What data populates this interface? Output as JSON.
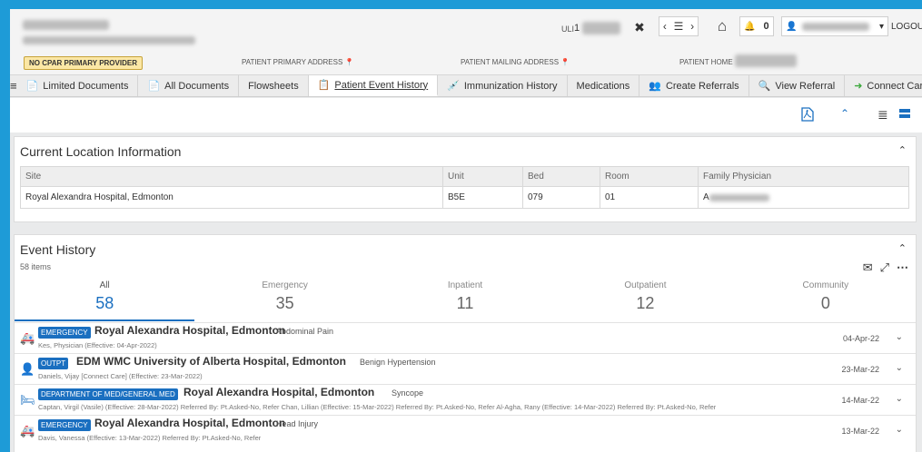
{
  "header": {
    "uli_label": "ULI",
    "uli_value": "1",
    "close_glyph": "✖",
    "nav_prev": "‹",
    "nav_list": "☰",
    "nav_next": "›",
    "home_glyph": "⌂",
    "bell_glyph": "🔔",
    "notification_count": "0",
    "user_glyph": "👤",
    "dropdown_glyph": "▾",
    "logout_label": "LOGOUT",
    "cpar_badge": "NO CPAR PRIMARY PROVIDER",
    "primary_address_label": "PATIENT PRIMARY ADDRESS",
    "mailing_address_label": "PATIENT MAILING ADDRESS",
    "patient_home_label": "PATIENT HOME",
    "pin_glyph": "📍"
  },
  "tabs": [
    {
      "label": "Limited Documents",
      "icon": "📄"
    },
    {
      "label": "All Documents",
      "icon": "📄"
    },
    {
      "label": "Flowsheets",
      "icon": ""
    },
    {
      "label": "Patient Event History",
      "icon": "📋"
    },
    {
      "label": "Immunization History",
      "icon": "💉"
    },
    {
      "label": "Medications",
      "icon": ""
    },
    {
      "label": "Create Referrals",
      "icon": "👥"
    },
    {
      "label": "View Referral",
      "icon": "🔍"
    },
    {
      "label": "Connect Care",
      "icon": "➜"
    }
  ],
  "location": {
    "title": "Current Location Information",
    "headers": [
      "Site",
      "Unit",
      "Bed",
      "Room",
      "Family Physician"
    ],
    "row": [
      "Royal Alexandra Hospital, Edmonton",
      "B5E",
      "079",
      "01",
      "A"
    ]
  },
  "events": {
    "title": "Event History",
    "count_text": "58 items",
    "categories": [
      {
        "label": "All",
        "count": "58"
      },
      {
        "label": "Emergency",
        "count": "35"
      },
      {
        "label": "Inpatient",
        "count": "11"
      },
      {
        "label": "Outpatient",
        "count": "12"
      },
      {
        "label": "Community",
        "count": "0"
      }
    ],
    "rows": [
      {
        "badge": "EMERGENCY",
        "site": "Royal Alexandra Hospital, Edmonton",
        "reason": "Abdominal Pain",
        "detail": "Kes, Physician (Effective: 04-Apr-2022)",
        "date": "04-Apr-22",
        "icon": "🚑",
        "icon_color": "#d9342b"
      },
      {
        "badge": "OUTPT",
        "site": "EDM WMC University of Alberta Hospital, Edmonton",
        "reason": "Benign Hypertension",
        "detail": "Daniels, Vijay [Connect Care] (Effective: 23-Mar-2022)",
        "date": "23-Mar-22",
        "icon": "👤",
        "icon_color": "#e08a00"
      },
      {
        "badge": "DEPARTMENT OF MED/GENERAL MED",
        "site": "Royal Alexandra Hospital, Edmonton",
        "reason": "Syncope",
        "detail": "Captan, Virgil (Vasile) (Effective: 28-Mar-2022) Referred By: Pt.Asked-No, Refer Chan, Lillian (Effective: 15-Mar-2022) Referred By: Pt.Asked-No, Refer Al-Agha, Rany (Effective: 14-Mar-2022) Referred By: Pt.Asked-No, Refer",
        "date": "14-Mar-22",
        "icon": "🛏",
        "icon_color": "#1a6fc0"
      },
      {
        "badge": "EMERGENCY",
        "site": "Royal Alexandra Hospital, Edmonton",
        "reason": "Head Injury",
        "detail": "Davis, Vanessa (Effective: 13-Mar-2022) Referred By: Pt.Asked-No, Refer",
        "date": "13-Mar-22",
        "icon": "🚑",
        "icon_color": "#d9342b"
      }
    ]
  }
}
